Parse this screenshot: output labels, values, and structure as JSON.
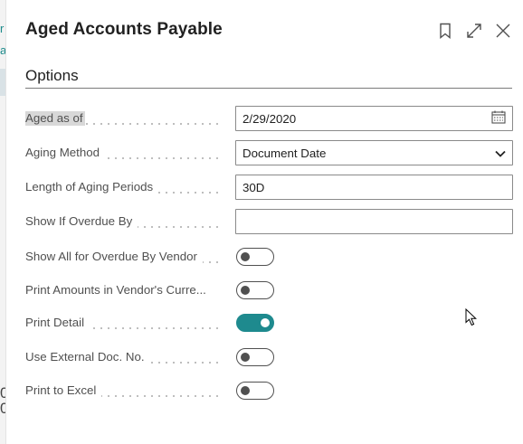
{
  "background": {
    "edge_marks": [
      "r",
      "a"
    ],
    "edge_numbers": [
      "0",
      "0"
    ]
  },
  "dialog": {
    "title": "Aged Accounts Payable",
    "header_icons": [
      "bookmark-icon",
      "expand-icon",
      "close-icon"
    ],
    "section_title": "Options",
    "fields": {
      "aged_as_of": {
        "label": "Aged as of",
        "value": "2/29/2020"
      },
      "aging_method": {
        "label": "Aging Method",
        "value": "Document Date",
        "options": [
          "Document Date"
        ]
      },
      "length_of_aging_periods": {
        "label": "Length of Aging Periods",
        "value": "30D"
      },
      "show_if_overdue_by": {
        "label": "Show If Overdue By",
        "value": ""
      },
      "show_all_overdue_vendor": {
        "label": "Show All for Overdue By Vendor",
        "checked": false
      },
      "print_amounts_vendor_currency": {
        "label": "Print Amounts in Vendor's Curre...",
        "checked": false
      },
      "print_detail": {
        "label": "Print Detail",
        "checked": true
      },
      "use_external_doc_no": {
        "label": "Use External Doc. No.",
        "checked": false
      },
      "print_to_excel": {
        "label": "Print to Excel",
        "checked": false
      }
    }
  },
  "colors": {
    "accent": "#1e8a8e",
    "text": "#212121",
    "label": "#505050",
    "field_border": "#8a8a8a"
  }
}
